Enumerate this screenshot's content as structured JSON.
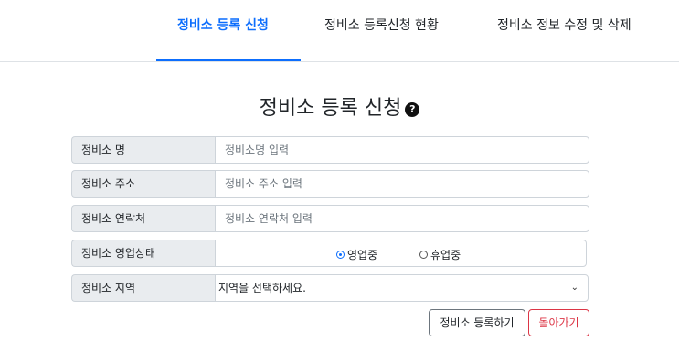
{
  "nav": {
    "tabs": [
      {
        "label": "정비소 등록 신청",
        "active": true
      },
      {
        "label": "정비소 등록신청 현황",
        "active": false
      },
      {
        "label": "정비소 정보 수정 및 삭제",
        "active": false
      }
    ]
  },
  "page_title": "정비소 등록 신청",
  "help_icon_glyph": "?",
  "form": {
    "name": {
      "label": "정비소 명",
      "placeholder": "정비소명 입력"
    },
    "address": {
      "label": "정비소 주소",
      "placeholder": "정비소 주소 입력"
    },
    "contact": {
      "label": "정비소 연락처",
      "placeholder": "정비소 연락처 입력"
    },
    "status": {
      "label": "정비소 영업상태",
      "options": [
        {
          "label": "영업중",
          "checked": true
        },
        {
          "label": "휴업중",
          "checked": false
        }
      ]
    },
    "region": {
      "label": "정비소 지역",
      "selected": "지역을 선택하세요."
    }
  },
  "buttons": {
    "register": "정비소 등록하기",
    "back": "돌아가기"
  },
  "colors": {
    "accent": "#0d6efd",
    "danger": "#dc3545",
    "label_bg": "#e9ecef"
  }
}
